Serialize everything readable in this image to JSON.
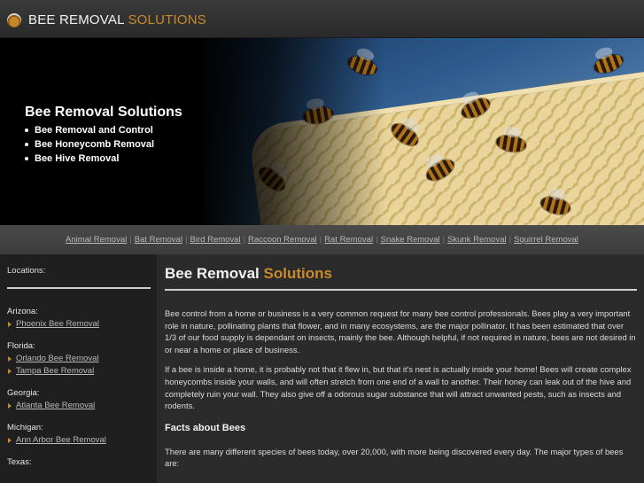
{
  "header": {
    "logo_word1": "BEE REMOVAL",
    "logo_word2": "SOLUTIONS"
  },
  "hero": {
    "title": "Bee Removal Solutions",
    "items": [
      "Bee Removal and Control",
      "Bee Honeycomb Removal",
      "Bee Hive Removal"
    ]
  },
  "nav": {
    "links": [
      "Animal Removal",
      "Bat Removal",
      "Bird Removal",
      "Raccoon Removal",
      "Rat Removal",
      "Snake Removal",
      "Skunk Removal",
      "Squirrel Removal"
    ]
  },
  "sidebar": {
    "heading": "Locations:",
    "states": [
      {
        "name": "Arizona:",
        "links": [
          "Phoenix Bee Removal"
        ]
      },
      {
        "name": "Florida:",
        "links": [
          "Orlando Bee Removal",
          "Tampa Bee Removal"
        ]
      },
      {
        "name": "Georgia:",
        "links": [
          "Atlanta Bee Removal"
        ]
      },
      {
        "name": "Michigan:",
        "links": [
          "Ann Arbor Bee Removal"
        ]
      },
      {
        "name": "Texas:",
        "links": []
      }
    ]
  },
  "main": {
    "title_word1": "Bee Removal",
    "title_word2": "Solutions",
    "para1": "Bee control from a home or business is a very common request for many bee control professionals. Bees play a very important role in nature, pollinating plants that flower, and in many ecosystems, are the major pollinator. It has been estimated that over 1/3 of our food supply is dependant on insects, mainly the bee. Although helpful, if not required in nature, bees are not desired in or near a home or place of business.",
    "para2": "If a bee is inside a home, it is probably not that it flew in, but that it's nest is actually inside your home! Bees will create complex honeycombs inside your walls, and will often stretch from one end of a wall to another. Their honey can leak out of the hive and completely ruin your wall. They also give off a odorous sugar substance that will attract unwanted pests, such as insects and rodents.",
    "subheading": "Facts about Bees",
    "para3": "There are many different species of bees today, over 20,000, with more being discovered every day. The major types of bees are:"
  },
  "colors": {
    "accent": "#c98a2c",
    "background": "#2b2b2b",
    "sidebar_bg": "#1f1f1f"
  }
}
